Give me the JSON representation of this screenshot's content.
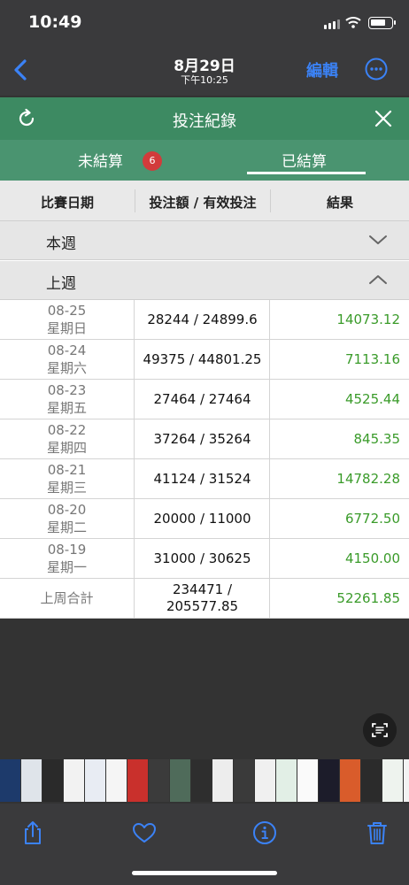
{
  "status_bar": {
    "time": "10:49"
  },
  "photo_nav": {
    "date": "8月29日",
    "subtitle": "下午10:25",
    "edit_label": "編輯"
  },
  "page": {
    "header_title": "投注紀錄",
    "tabs": {
      "unsettled_label": "未結算",
      "unsettled_count": "6",
      "settled_label": "已結算"
    },
    "columns": [
      "比賽日期",
      "投注額 / 有效投注",
      "結果"
    ],
    "groups": {
      "this_week": "本週",
      "last_week": "上週"
    },
    "rows": [
      {
        "date": "08-25",
        "weekday": "星期日",
        "amount": "28244 / 24899.6",
        "result": "14073.12"
      },
      {
        "date": "08-24",
        "weekday": "星期六",
        "amount": "49375 / 44801.25",
        "result": "7113.16"
      },
      {
        "date": "08-23",
        "weekday": "星期五",
        "amount": "27464 / 27464",
        "result": "4525.44"
      },
      {
        "date": "08-22",
        "weekday": "星期四",
        "amount": "37264 / 35264",
        "result": "845.35"
      },
      {
        "date": "08-21",
        "weekday": "星期三",
        "amount": "41124 / 31524",
        "result": "14782.28"
      },
      {
        "date": "08-20",
        "weekday": "星期二",
        "amount": "20000 / 11000",
        "result": "6772.50"
      },
      {
        "date": "08-19",
        "weekday": "星期一",
        "amount": "31000 / 30625",
        "result": "4150.00"
      }
    ],
    "total": {
      "label": "上周合計",
      "amount_line1": "234471 /",
      "amount_line2": "205577.85",
      "result": "52261.85"
    }
  },
  "colors": {
    "header_green": "#3d8a62",
    "tabs_green": "#4a9470",
    "result_green": "#3a9b2a",
    "ios_blue": "#3b82f6",
    "badge_red": "#d23b3b"
  },
  "icons": [
    "back-chevron-icon",
    "more-icon",
    "refresh-icon",
    "close-icon",
    "chevron-down-icon",
    "chevron-up-icon",
    "live-text-icon",
    "share-icon",
    "heart-icon",
    "info-icon",
    "trash-icon"
  ]
}
